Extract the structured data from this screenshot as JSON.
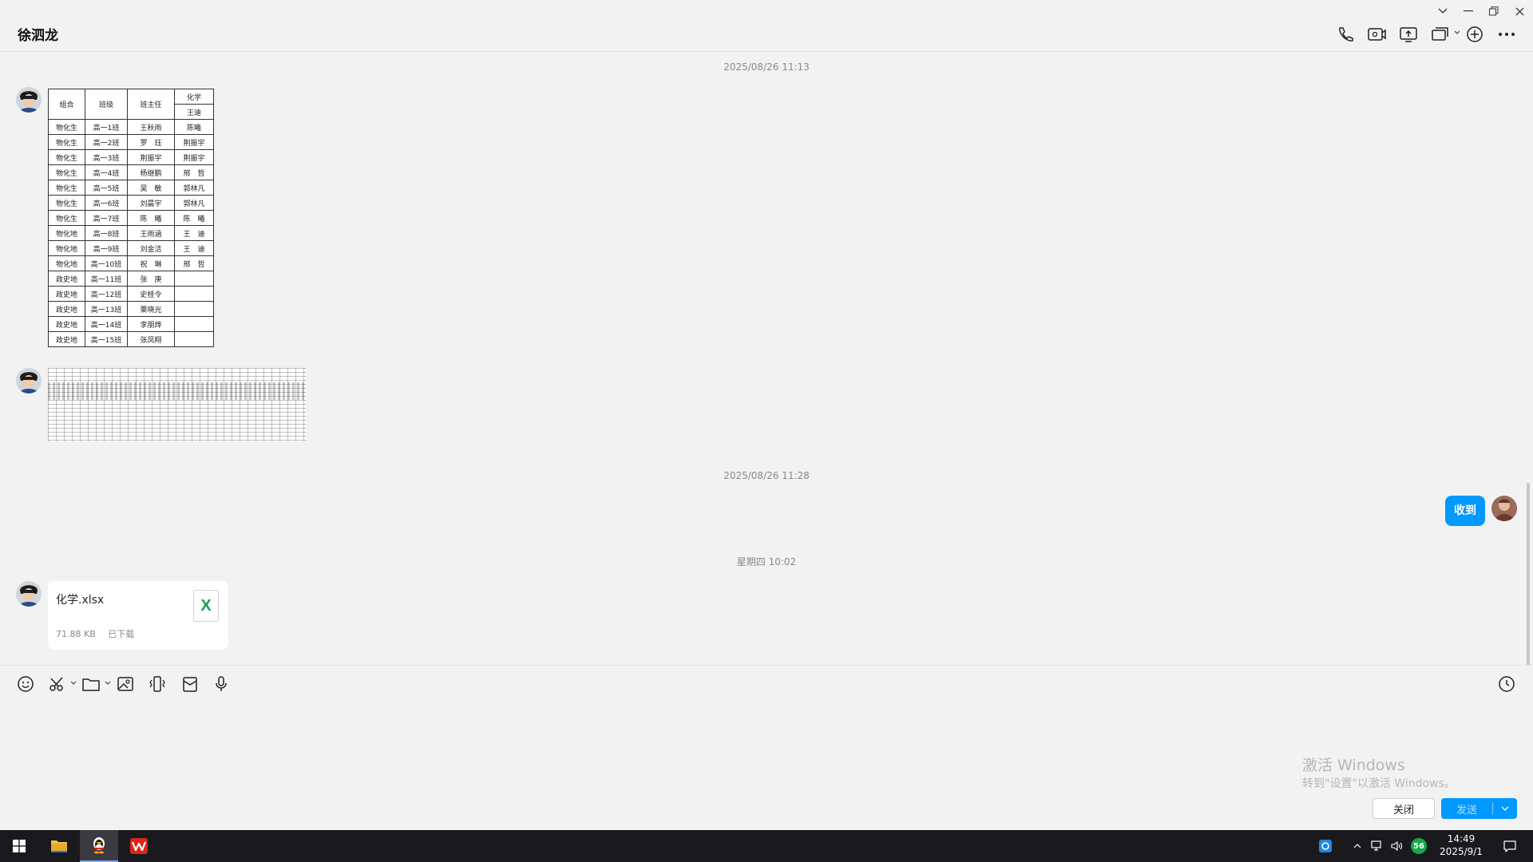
{
  "window": {
    "title": "徐泗龙"
  },
  "messages": {
    "timestamps": [
      "2025/08/26 11:13",
      "2025/08/26 11:28",
      "星期四 10:02"
    ],
    "schedule_table": {
      "headers": [
        "组合",
        "班级",
        "班主任",
        "化学",
        "王迪"
      ],
      "rows": [
        [
          "物化生",
          "高一1班",
          "王秋雨",
          "陈曦"
        ],
        [
          "物化生",
          "高一2班",
          "罗　珏",
          "荆振宇"
        ],
        [
          "物化生",
          "高一3班",
          "荆振宇",
          "荆振宇"
        ],
        [
          "物化生",
          "高一4班",
          "杨继鹏",
          "邢　哲"
        ],
        [
          "物化生",
          "高一5班",
          "吴　敏",
          "郭林凡"
        ],
        [
          "物化生",
          "高一6班",
          "刘晨宇",
          "郭林凡"
        ],
        [
          "物化生",
          "高一7班",
          "陈　曦",
          "陈　曦"
        ],
        [
          "物化地",
          "高一8班",
          "王雨涵",
          "王　迪"
        ],
        [
          "物化地",
          "高一9班",
          "刘金洁",
          "王　迪"
        ],
        [
          "物化地",
          "高一10班",
          "祝　琳",
          "邢　哲"
        ],
        [
          "政史地",
          "高一11班",
          "张　庚",
          ""
        ],
        [
          "政史地",
          "高一12班",
          "史桂令",
          ""
        ],
        [
          "政史地",
          "高一13班",
          "栗晓光",
          ""
        ],
        [
          "政史地",
          "高一14班",
          "李朋烨",
          ""
        ],
        [
          "政史地",
          "高一15班",
          "张凤翔",
          ""
        ]
      ]
    },
    "sent_text": "收到",
    "file": {
      "name": "化学.xlsx",
      "size": "71.88 KB",
      "status": "已下载",
      "icon_letter": "X"
    }
  },
  "input": {
    "close_label": "关闭",
    "send_label": "发送",
    "watermark_title": "激活 Windows",
    "watermark_sub": "转到\"设置\"以激活 Windows。"
  },
  "taskbar": {
    "time": "14:49",
    "date": "2025/9/1",
    "badge": "56"
  },
  "colors": {
    "accent": "#0099ff",
    "excel": "#1d9e4d",
    "taskbar": "#1a1a1e"
  }
}
